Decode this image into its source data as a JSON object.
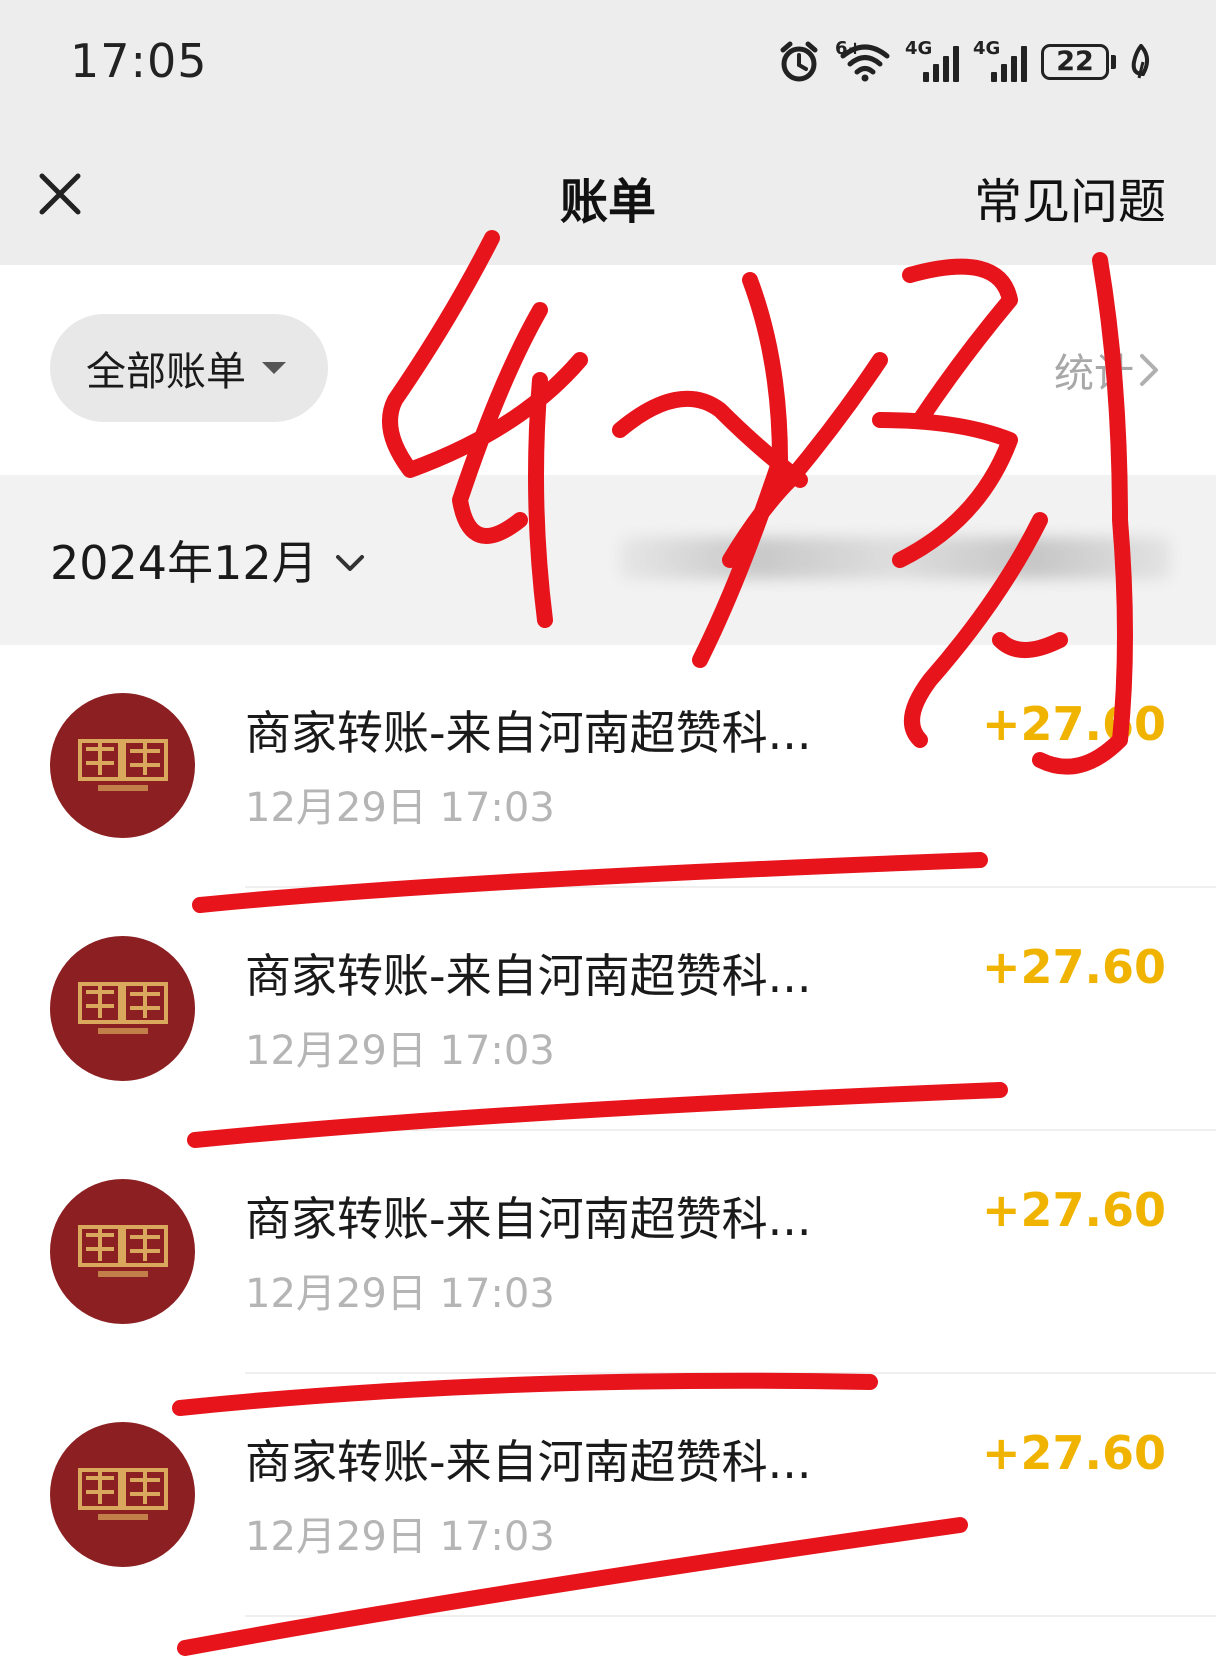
{
  "status_bar": {
    "time": "17:05",
    "signal_1_label": "4G",
    "signal_2_label": "4G",
    "wifi_label": "6+",
    "battery": "22",
    "icons": [
      "alarm-icon",
      "wifi-icon",
      "signal-icon",
      "signal-icon",
      "battery-icon",
      "leaf-icon"
    ]
  },
  "header": {
    "close_icon": "close-icon",
    "title": "账单",
    "faq_label": "常见问题"
  },
  "filter": {
    "all_bills_label": "全部账单",
    "stats_label": "统计"
  },
  "month": {
    "label": "2024年12月"
  },
  "transactions": [
    {
      "title": "商家转账-来自河南超赞科...",
      "time": "12月29日 17:03",
      "amount": "+27.60"
    },
    {
      "title": "商家转账-来自河南超赞科...",
      "time": "12月29日 17:03",
      "amount": "+27.60"
    },
    {
      "title": "商家转账-来自河南超赞科...",
      "time": "12月29日 17:03",
      "amount": "+27.60"
    },
    {
      "title": "商家转账-来自河南超赞科...",
      "time": "12月29日 17:03",
      "amount": "+27.60"
    }
  ],
  "colors": {
    "amount": "#f0b400",
    "avatar": "#8c1f21",
    "annotation": "#e8141c"
  }
}
